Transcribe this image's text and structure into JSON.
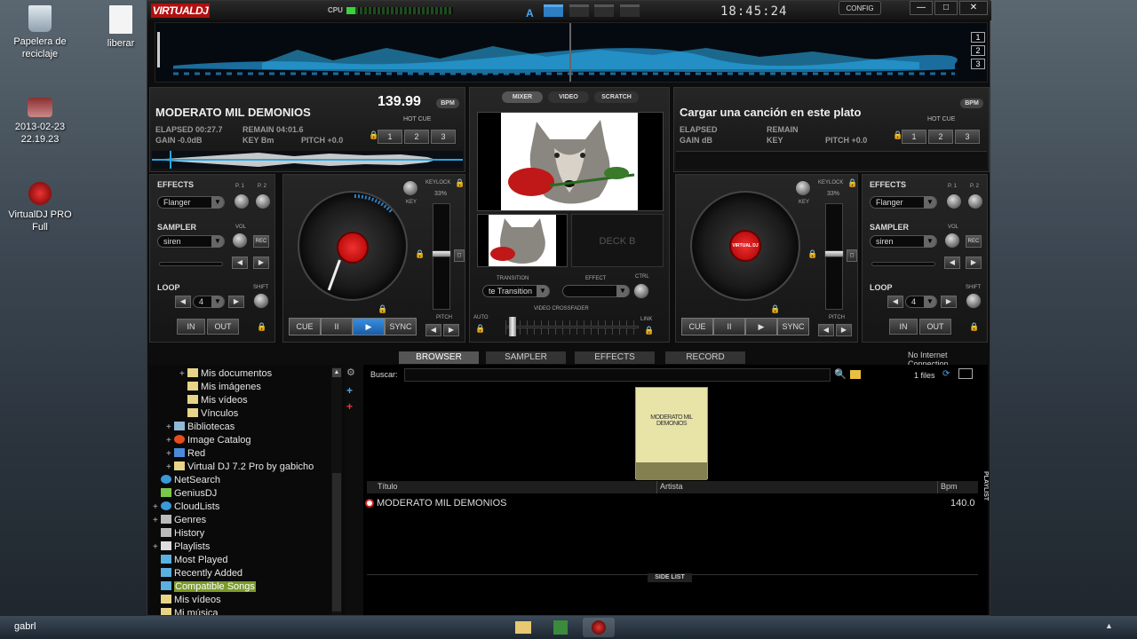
{
  "desktop": {
    "icons": [
      {
        "label": "Papelera de reciclaje"
      },
      {
        "label": "liberar"
      },
      {
        "label": "2013-02-23 22.19.23"
      },
      {
        "label": "VirtualDJ PRO Full"
      }
    ]
  },
  "titlebar": {
    "logo": "VIRTUALDJ",
    "cpu_label": "CPU",
    "clock": "18:45:24",
    "config": "CONFIG",
    "minimize": "—",
    "maximize": "□",
    "close": "✕"
  },
  "waveform": {
    "pages": [
      "1",
      "2",
      "3"
    ]
  },
  "deckA": {
    "title": "MODERATO MIL DEMONIOS",
    "bpm": "139.99",
    "bpm_button": "BPM",
    "elapsed": "ELAPSED 00:27.7",
    "remain": "REMAIN 04:01.6",
    "gain": "GAIN -0.0dB",
    "key": "KEY Bm",
    "pitch": "PITCH +0.0",
    "hotcue_label": "HOT CUE",
    "hotcues": [
      "1",
      "2",
      "3"
    ]
  },
  "deckB": {
    "title": "Cargar una canción en este plato",
    "bpm_button": "BPM",
    "elapsed": "ELAPSED",
    "remain": "REMAIN",
    "gain": "GAIN dB",
    "key": "KEY",
    "pitch": "PITCH +0.0",
    "hotcue_label": "HOT CUE",
    "hotcues": [
      "1",
      "2",
      "3"
    ]
  },
  "fxA": {
    "effects": "EFFECTS",
    "p1": "P. 1",
    "p2": "P. 2",
    "effect_value": "Flanger",
    "sampler": "SAMPLER",
    "vol": "VOL",
    "sampler_value": "siren",
    "rec": "REC",
    "loop": "LOOP",
    "shift": "SHIFT",
    "loop_value": "4",
    "in": "IN",
    "out": "OUT"
  },
  "fxB": {
    "effects": "EFFECTS",
    "p1": "P. 1",
    "p2": "P. 2",
    "effect_value": "Flanger",
    "sampler": "SAMPLER",
    "vol": "VOL",
    "sampler_value": "siren",
    "rec": "REC",
    "loop": "LOOP",
    "shift": "SHIFT",
    "loop_value": "4",
    "in": "IN",
    "out": "OUT"
  },
  "ttA": {
    "keylock": "KEYLOCK",
    "keylock_pct": "33%",
    "key": "KEY",
    "pitch": "PITCH",
    "cue": "CUE",
    "pause": "II",
    "play": "▶",
    "sync": "SYNC"
  },
  "ttB": {
    "keylock": "KEYLOCK",
    "keylock_pct": "33%",
    "key": "KEY",
    "pitch": "PITCH",
    "cue": "CUE",
    "pause": "II",
    "play": "▶",
    "sync": "SYNC",
    "label_text": "VIRTUAL DJ"
  },
  "mixer": {
    "tabs": [
      "MIXER",
      "VIDEO",
      "SCRATCH"
    ],
    "deck_b": "DECK B",
    "transition_label": "TRANSITION",
    "transition_value": "te Transition",
    "effect_label": "EFFECT",
    "ctrl": "CTRL",
    "crossfader": "VIDEO CROSSFADER",
    "auto": "AUTO",
    "link": "LINK"
  },
  "browser": {
    "tabs": [
      "BROWSER",
      "SAMPLER",
      "EFFECTS",
      "RECORD"
    ],
    "no_internet": "No Internet Connection",
    "buscar": "Buscar:",
    "files": "1 files",
    "cover_text": "MODERATO MIL DEMONIOS",
    "columns": [
      "Título",
      "Artista",
      "Bpm"
    ],
    "rows": [
      {
        "title": "MODERATO MIL DEMONIOS",
        "artist": "",
        "bpm": "140.0"
      }
    ],
    "side_list": "SIDE LIST",
    "playlist": "PLAYLIST",
    "tree": [
      {
        "label": "Mis documentos"
      },
      {
        "label": "Mis imágenes"
      },
      {
        "label": "Mis vídeos"
      },
      {
        "label": "Vínculos"
      },
      {
        "label": "Bibliotecas"
      },
      {
        "label": "Image Catalog"
      },
      {
        "label": "Red"
      },
      {
        "label": "Virtual DJ 7.2 Pro by gabicho"
      },
      {
        "label": "NetSearch"
      },
      {
        "label": "GeniusDJ"
      },
      {
        "label": "CloudLists"
      },
      {
        "label": "Genres"
      },
      {
        "label": "History"
      },
      {
        "label": "Playlists"
      },
      {
        "label": "Most Played"
      },
      {
        "label": "Recently Added"
      },
      {
        "label": "Compatible Songs"
      },
      {
        "label": "Mis vídeos"
      },
      {
        "label": "Mi música"
      }
    ]
  },
  "taskbar": {
    "user": "gabrl"
  },
  "colors": {
    "accent": "#2d7ec3",
    "logo": "#b01010",
    "wave": "#2aa6e0"
  }
}
